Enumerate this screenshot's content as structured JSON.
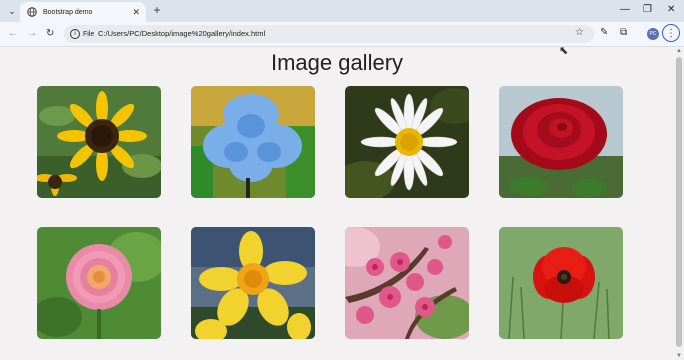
{
  "browser": {
    "tab_title": "Bootstrap demo",
    "tab_close": "✕",
    "new_tab": "+",
    "info_label": "File",
    "url": "C:/Users/PC/Desktop/image%20gallery/index.html",
    "profile_initials": "PC"
  },
  "page": {
    "heading": "Image gallery"
  },
  "gallery": {
    "images": [
      {
        "subject": "sunflower"
      },
      {
        "subject": "blue iris"
      },
      {
        "subject": "white daisy"
      },
      {
        "subject": "red rose"
      },
      {
        "subject": "pink dahlia"
      },
      {
        "subject": "yellow daffodil"
      },
      {
        "subject": "pink peach blossom"
      },
      {
        "subject": "red poppy"
      }
    ]
  },
  "icons": {
    "back": "back-arrow-icon",
    "forward": "forward-arrow-icon",
    "reload": "reload-icon",
    "bookmark": "star-icon",
    "extensions": "puzzle-icon",
    "menu": "kebab-menu-icon"
  }
}
